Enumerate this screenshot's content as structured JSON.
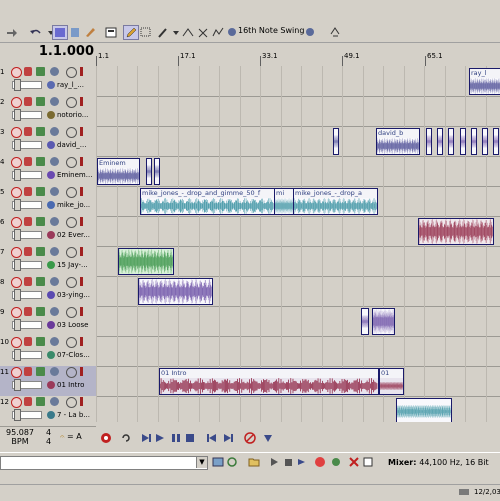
{
  "toolbar": {
    "swing_label": "16th Note Swing"
  },
  "time": {
    "position": "1.1.000"
  },
  "ruler": {
    "labels": [
      "1.1",
      "17.1",
      "33.1",
      "49.1",
      "65.1"
    ]
  },
  "tracks": [
    {
      "number": "1",
      "name": "ray_l_..."
    },
    {
      "number": "2",
      "name": "notorio..."
    },
    {
      "number": "3",
      "name": "david_..."
    },
    {
      "number": "4",
      "name": "Eminem..."
    },
    {
      "number": "5",
      "name": "mike_jo..."
    },
    {
      "number": "6",
      "name": "02 Ever..."
    },
    {
      "number": "7",
      "name": "15 Jay-..."
    },
    {
      "number": "8",
      "name": "03-ying..."
    },
    {
      "number": "9",
      "name": "03 Loose"
    },
    {
      "number": "10",
      "name": "07-Clos..."
    },
    {
      "number": "11",
      "name": "01 Intro"
    },
    {
      "number": "12",
      "name": "7 - La b..."
    }
  ],
  "clips": {
    "ray": "ray_l",
    "david": "david_b",
    "eminem": "Eminem",
    "mike1": "mike_jones_-_drop_and_gimme_50_f",
    "mike2": "mi",
    "mike3": "mike_jones_-_drop_a",
    "intro": "01 Intro",
    "intro2": "01"
  },
  "transport": {
    "tempo_value": "95.087",
    "tempo_label": "BPM",
    "meter_top": "4",
    "meter_bottom": "4",
    "key": "= A"
  },
  "mixer": {
    "label": "Mixer:",
    "value": "44,100 Hz, 16 Bit"
  },
  "status": {
    "date": "12/2,03"
  },
  "colors": {
    "blue_wave": "#3a3a8a",
    "teal_wave": "#2a8a9a",
    "red_wave": "#8a1a3a",
    "green_wave": "#2a8a3a",
    "purple_wave": "#5a3a9a"
  }
}
